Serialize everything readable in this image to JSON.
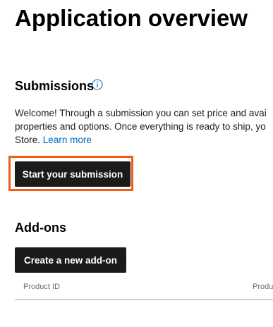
{
  "page": {
    "title": "Application overview"
  },
  "submissions": {
    "heading": "Submissions",
    "info_icon": "info-circle-icon",
    "description_line1": "Welcome! Through a submission you can set price and avai",
    "description_line2": "properties and options. Once everything is ready to ship, yo",
    "description_line3_prefix": "Store.",
    "learn_more_label": "Learn more",
    "start_button_label": "Start your submission"
  },
  "addons": {
    "heading": "Add-ons",
    "create_button_label": "Create a new add-on",
    "table": {
      "columns": [
        "Product ID",
        "Produ"
      ]
    }
  },
  "colors": {
    "button_background": "#1b1b1b",
    "link": "#0067b8",
    "highlight": "#f25c14",
    "info_icon": "#0067b8"
  }
}
